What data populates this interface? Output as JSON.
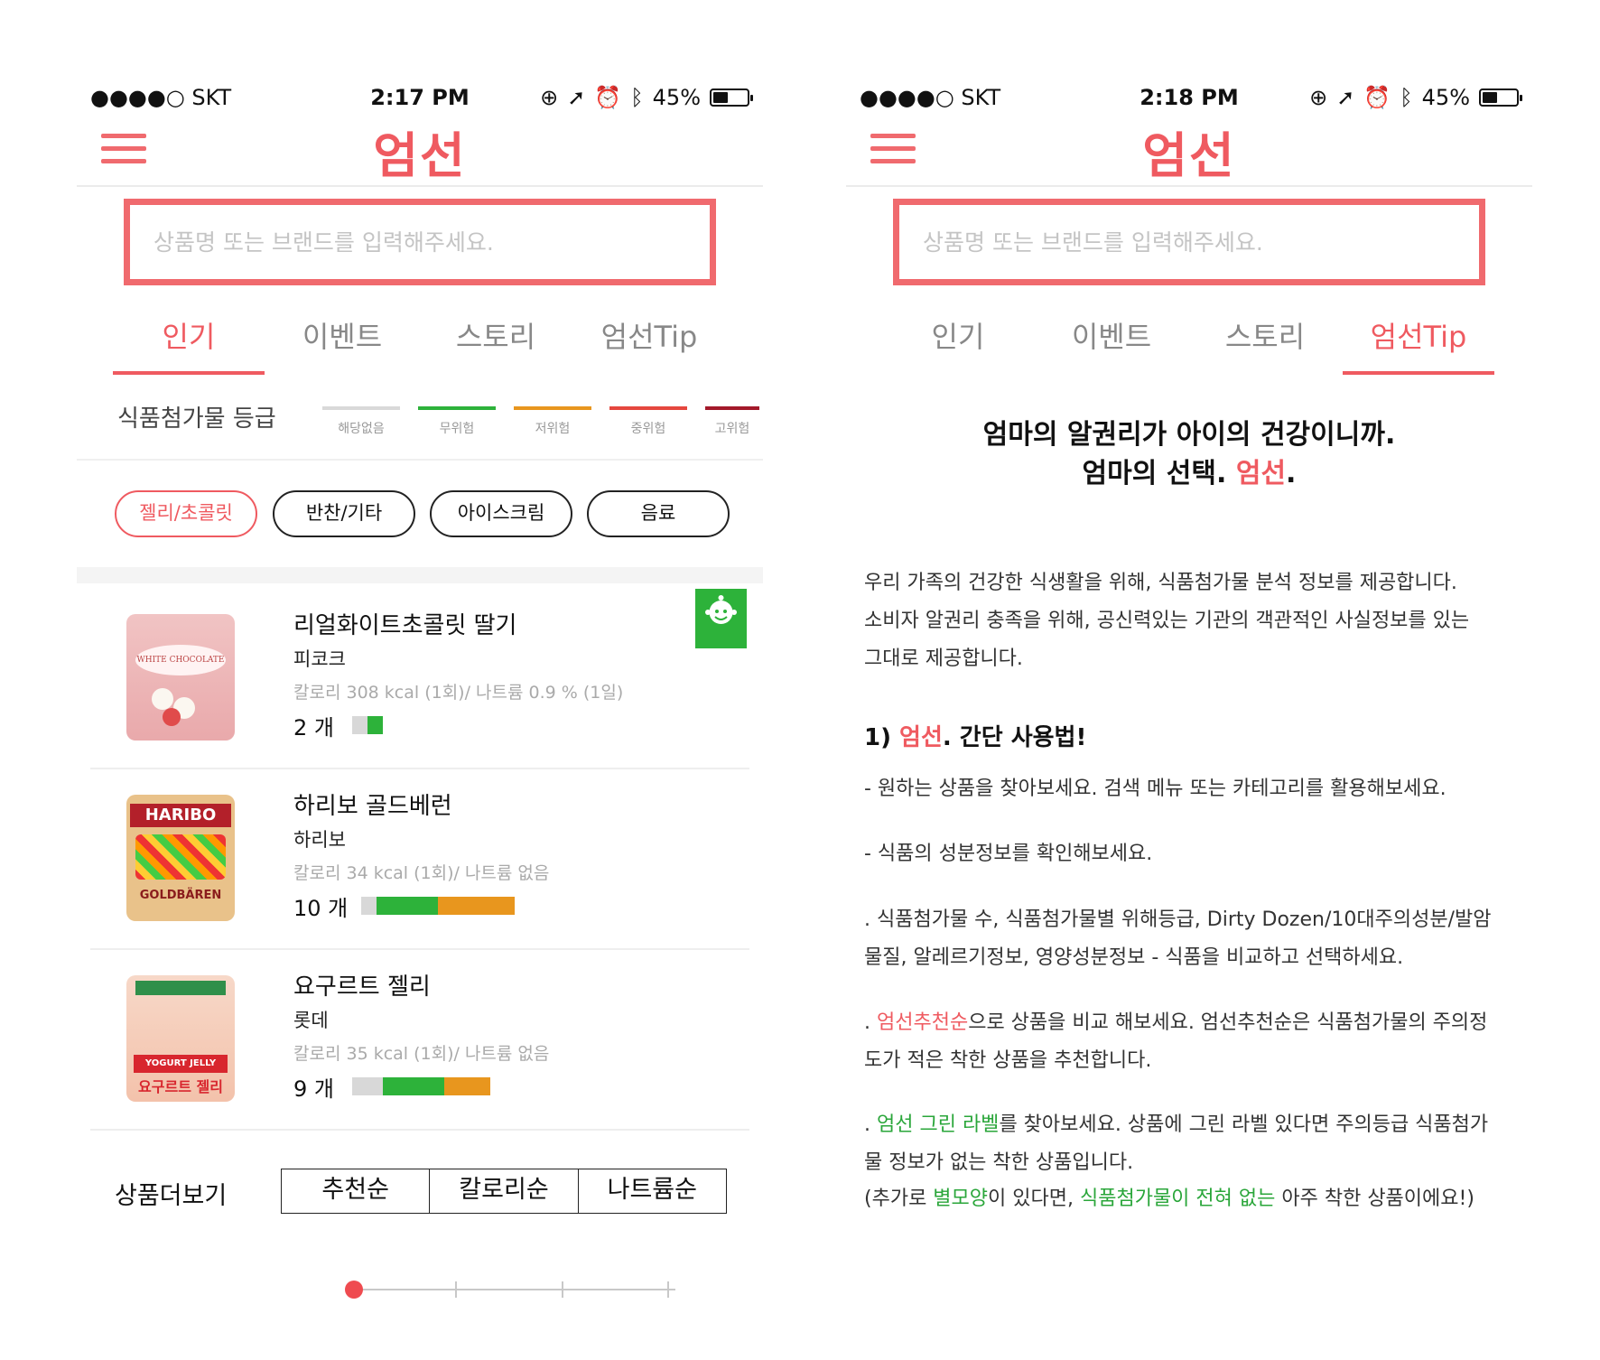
{
  "colors": {
    "accent": "#ef5a60",
    "green": "#2db23a",
    "orange": "#e8961e",
    "grey": "#d8d8d8",
    "darkred": "#a3192a"
  },
  "screens": [
    {
      "status": {
        "carrier": "●●●●○ SKT",
        "time": "2:17 PM",
        "battery": "45%"
      },
      "logo": "엄선",
      "search_placeholder": "상품명 또는 브랜드를 입력해주세요.",
      "tabs": [
        "인기",
        "이벤트",
        "스토리",
        "엄선Tip"
      ],
      "active_tab": 0,
      "grade_title": "식품첨가물 등급",
      "grades": [
        {
          "label": "해당없음",
          "color": "#d9d9d9"
        },
        {
          "label": "무위험",
          "color": "#2db23a"
        },
        {
          "label": "저위험",
          "color": "#e8961e"
        },
        {
          "label": "중위험",
          "color": "#e5473e"
        },
        {
          "label": "고위험",
          "color": "#a3192a"
        }
      ],
      "chips": [
        "젤리/초콜릿",
        "반찬/기타",
        "아이스크림",
        "음료"
      ],
      "active_chip": 0,
      "products": [
        {
          "name": "리얼화이트초콜릿 딸기",
          "brand": "피코크",
          "info": "칼로리 308 kcal (1회)/ 나트륨 0.9 % (1일)",
          "count": "2 개",
          "thumb_label": "WHITE CHOCOLATE",
          "green_badge": true,
          "grade_counts": {
            "none": 1,
            "safe": 1,
            "low": 0
          }
        },
        {
          "name": "하리보 골드베런",
          "brand": "하리보",
          "info": "칼로리 34 kcal (1회)/ 나트륨 없음",
          "count": "10 개",
          "thumb_label": "HARIBO",
          "thumb_label2": "GOLDBÄREN",
          "green_badge": false,
          "grade_counts": {
            "none": 1,
            "safe": 4,
            "low": 5
          }
        },
        {
          "name": "요구르트 젤리",
          "brand": "롯데",
          "info": "칼로리 35 kcal (1회)/ 나트륨 없음",
          "count": "9 개",
          "thumb_label": "요구르트 젤리",
          "thumb_label2": "YOGURT JELLY",
          "green_badge": false,
          "grade_counts": {
            "none": 2,
            "safe": 4,
            "low": 3
          }
        }
      ],
      "more_label": "상품더보기",
      "sort_options": [
        "추천순",
        "칼로리순",
        "나트륨순"
      ],
      "pager": {
        "current": 1,
        "total": 4
      }
    },
    {
      "status": {
        "carrier": "●●●●○ SKT",
        "time": "2:18 PM",
        "battery": "45%"
      },
      "logo": "엄선",
      "search_placeholder": "상품명 또는 브랜드를 입력해주세요.",
      "tabs": [
        "인기",
        "이벤트",
        "스토리",
        "엄선Tip"
      ],
      "active_tab": 3,
      "headline1": "엄마의 알권리가 아이의 건강이니까.",
      "headline2_a": "엄마의 선택. ",
      "headline2_b": "엄선",
      "headline2_c": ".",
      "intro1": "우리 가족의 건강한 식생활을 위해, 식품첨가물 분석 정보를 제공합니다.",
      "intro2": "소비자 알권리 충족을 위해, 공신력있는 기관의 객관적인 사실정보를 있는",
      "intro3": "그대로 제공합니다.",
      "subhead_a": "1) ",
      "subhead_b": "엄선",
      "subhead_c": ". 간단 사용법!",
      "tip1": "- 원하는 상품을 찾아보세요. 검색 메뉴 또는 카테고리를 활용해보세요.",
      "tip2": "- 식품의 성분정보를 확인해보세요.",
      "tip3a": ". 식품첨가물 수, 식품첨가물별 위해등급, Dirty Dozen/10대주의성분/발암",
      "tip3b": "물질, 알레르기정보, 영양성분정보 - 식품을 비교하고 선택하세요.",
      "tip4_dot": ". ",
      "tip4_red": "엄선추천순",
      "tip4a": "으로 상품을 비교 해보세요. 엄선추천순은 식품첨가물의 주의정",
      "tip4b": "도가 적은 착한 상품을 추천합니다.",
      "tip5_dot": ". ",
      "tip5_green": "엄선 그린 라벨",
      "tip5a": "를 찾아보세요. 상품에 그린 라벨 있다면 주의등급 식품첨가",
      "tip5b": "물 정보가 없는 착한 상품입니다.",
      "tip6_a": "(추가로 ",
      "tip6_green1": "별모양",
      "tip6_b": "이 있다면, ",
      "tip6_green2": "식품첨가물이 전혀 없는",
      "tip6_c": " 아주 착한 상품이에요!)"
    }
  ]
}
